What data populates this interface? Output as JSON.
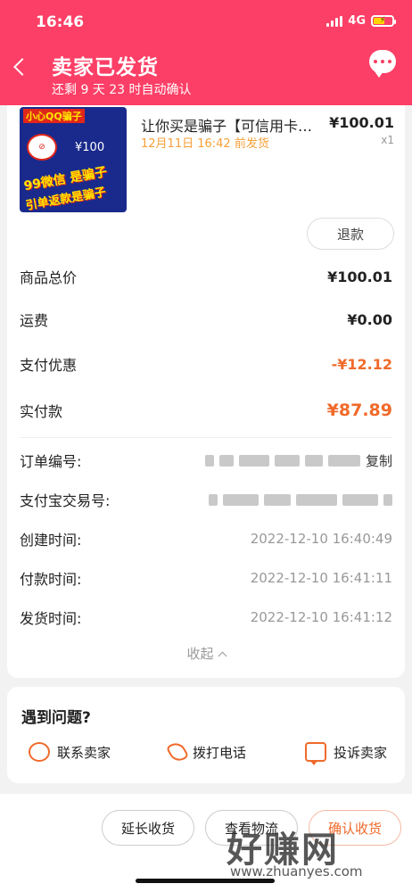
{
  "status_bar": {
    "time": "16:46",
    "network": "4G"
  },
  "header": {
    "title": "卖家已发货",
    "subtitle": "还剩 9 天 23 时自动确认"
  },
  "product": {
    "title": "让你买是骗子【可信用卡…",
    "price": "¥100.01",
    "ship_note": "12月11日 16:42 前发货",
    "quantity": "x1",
    "refund_label": "退款",
    "thumbnail_text": [
      "小心QQ骗子",
      "¥100",
      "99微信 是骗子",
      "引单返款是骗子"
    ]
  },
  "summary": [
    {
      "label": "商品总价",
      "value": "¥100.01"
    },
    {
      "label": "运费",
      "value": "¥0.00"
    },
    {
      "label": "支付优惠",
      "value": "-¥12.12"
    },
    {
      "label": "实付款",
      "value": "¥87.89"
    }
  ],
  "order_info": {
    "order_no_label": "订单编号:",
    "copy_label": "复制",
    "alipay_label": "支付宝交易号:",
    "created_label": "创建时间:",
    "created_value": "2022-12-10 16:40:49",
    "paid_label": "付款时间:",
    "paid_value": "2022-12-10 16:41:11",
    "shipped_label": "发货时间:",
    "shipped_value": "2022-12-10 16:41:12",
    "collapse_label": "收起"
  },
  "problem": {
    "title": "遇到问题?",
    "actions": [
      {
        "label": "联系卖家",
        "icon": "smile-icon"
      },
      {
        "label": "拨打电话",
        "icon": "phone-icon"
      },
      {
        "label": "投诉卖家",
        "icon": "complaint-icon"
      }
    ]
  },
  "bottom_bar": {
    "extend_label": "延长收货",
    "logistics_label": "查看物流",
    "confirm_label": "确认收货"
  },
  "watermark": {
    "text": "好赚网",
    "url": "www.zhuanyes.com"
  },
  "colors": {
    "brand": "#fc3f66",
    "accent": "#f06a2a",
    "note": "#f5a03a"
  }
}
